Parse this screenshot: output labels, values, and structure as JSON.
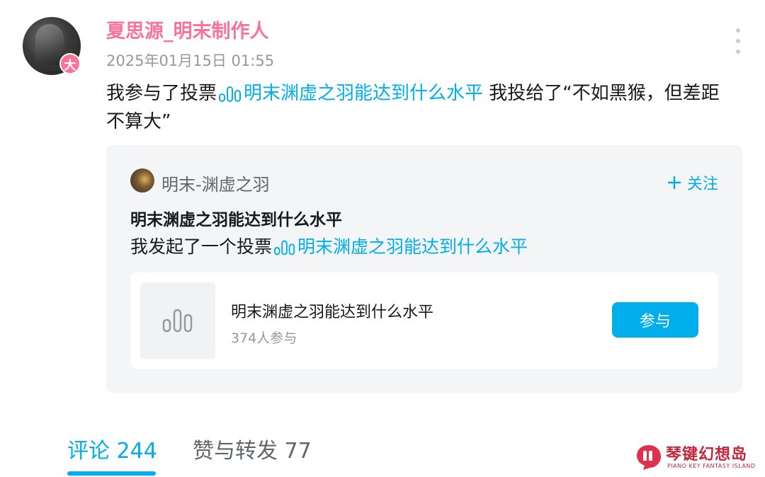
{
  "post": {
    "username": "夏思源_明末制作人",
    "avatar_badge": "大",
    "timestamp": "2025年01月15日 01:55",
    "text_prefix": "我参与了投票",
    "vote_link": "明末渊虚之羽能达到什么水平",
    "text_suffix": " 我投给了“不如黑猴，但差距不算大”"
  },
  "shared_card": {
    "source_name": "明末-渊虚之羽",
    "follow_icon": "plus-icon",
    "follow_label": "关注",
    "title": "明末渊虚之羽能达到什么水平",
    "desc_prefix": "我发起了一个投票",
    "desc_link": "明末渊虚之羽能达到什么水平",
    "vote": {
      "icon": "vote-chart-icon",
      "name": "明末渊虚之羽能达到什么水平",
      "participants": "374人参与",
      "join_label": "参与"
    }
  },
  "tabs": [
    {
      "label": "评论 244",
      "active": true
    },
    {
      "label": "赞与转发 77",
      "active": false
    }
  ],
  "watermark": {
    "title": "琴键幻想岛",
    "subtitle": "PIANO KEY FANTASY ISLAND"
  },
  "colors": {
    "accent": "#00aeec",
    "username": "#fb7299",
    "watermark": "#c2273b"
  }
}
